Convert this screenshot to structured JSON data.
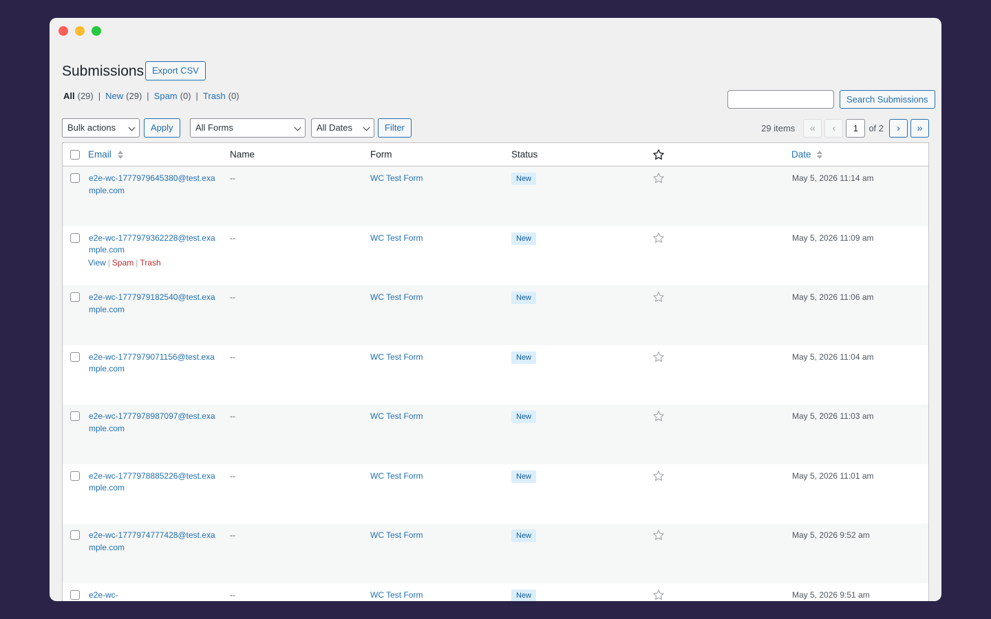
{
  "page": {
    "title": "Submissions",
    "export_label": "Export CSV"
  },
  "views": [
    {
      "label": "All",
      "count": "(29)",
      "current": true
    },
    {
      "label": "New",
      "count": "(29)"
    },
    {
      "label": "Spam",
      "count": "(0)"
    },
    {
      "label": "Trash",
      "count": "(0)"
    }
  ],
  "search": {
    "value": "",
    "button_label": "Search Submissions"
  },
  "tablenav": {
    "bulk_actions": "Bulk actions",
    "apply_label": "Apply",
    "forms_filter": "All Forms",
    "dates_filter": "All Dates",
    "filter_label": "Filter",
    "items_count": "29 items",
    "first_page": "«",
    "prev_page": "‹",
    "current_page": "1",
    "of_pages": "of 2",
    "next_page": "›",
    "last_page": "»"
  },
  "columns": {
    "email": "Email",
    "name": "Name",
    "form": "Form",
    "status": "Status",
    "date": "Date"
  },
  "row_actions": {
    "view": "View",
    "spam": "Spam",
    "trash": "Trash"
  },
  "rows": [
    {
      "email": "e2e-wc-1777979645380@test.example.com",
      "name": "--",
      "form": "WC Test Form",
      "status": "New",
      "date": "May 5, 2026 11:14 am"
    },
    {
      "email": "e2e-wc-1777979362228@test.example.com",
      "name": "--",
      "form": "WC Test Form",
      "status": "New",
      "date": "May 5, 2026 11:09 am",
      "show_actions": true
    },
    {
      "email": "e2e-wc-1777979182540@test.example.com",
      "name": "--",
      "form": "WC Test Form",
      "status": "New",
      "date": "May 5, 2026 11:06 am"
    },
    {
      "email": "e2e-wc-1777979071156@test.example.com",
      "name": "--",
      "form": "WC Test Form",
      "status": "New",
      "date": "May 5, 2026 11:04 am"
    },
    {
      "email": "e2e-wc-1777978987097@test.example.com",
      "name": "--",
      "form": "WC Test Form",
      "status": "New",
      "date": "May 5, 2026 11:03 am"
    },
    {
      "email": "e2e-wc-1777978885226@test.example.com",
      "name": "--",
      "form": "WC Test Form",
      "status": "New",
      "date": "May 5, 2026 11:01 am"
    },
    {
      "email": "e2e-wc-1777974777428@test.example.com",
      "name": "--",
      "form": "WC Test Form",
      "status": "New",
      "date": "May 5, 2026 9:52 am"
    },
    {
      "email": "e2e-wc-",
      "name": "--",
      "form": "WC Test Form",
      "status": "New",
      "date": "May 5, 2026 9:51 am"
    }
  ],
  "colors": {
    "accent": "#2271b1",
    "danger": "#b32d2e",
    "badge_bg": "#dbeefb",
    "window_bg": "#f0f0f1",
    "desktop_bg": "#2b2448"
  },
  "icons": {
    "star": "star-outline-icon",
    "sort": "sort-arrows-icon",
    "dropdown": "chevron-down-icon"
  }
}
